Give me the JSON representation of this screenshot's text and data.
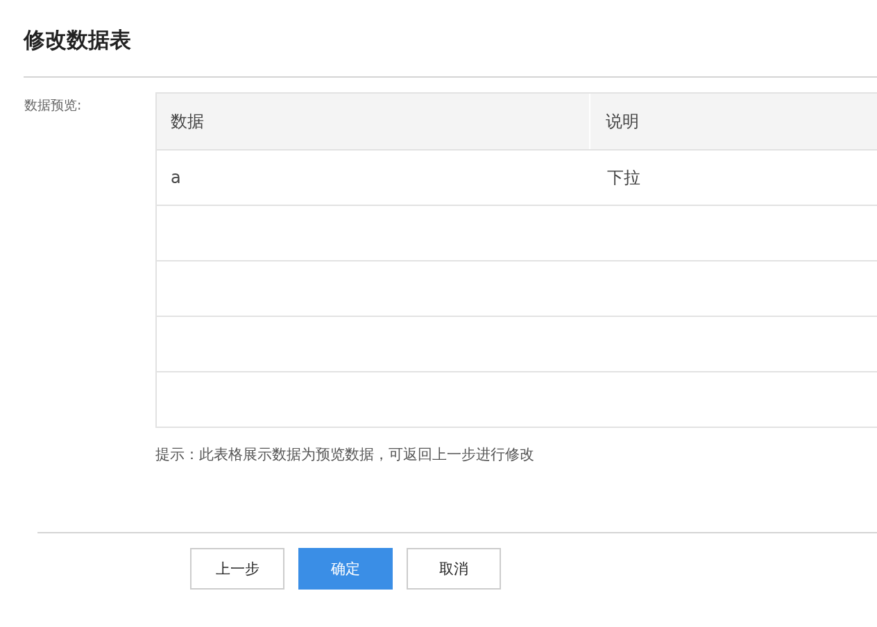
{
  "title": "修改数据表",
  "preview_label": "数据预览:",
  "table": {
    "columns": [
      "数据",
      "说明"
    ],
    "rows": [
      {
        "cells": [
          "a",
          "下拉"
        ]
      }
    ]
  },
  "hint": "提示：此表格展示数据为预览数据，可返回上一步进行修改",
  "buttons": [
    {
      "label": "上一步",
      "kind": "default"
    },
    {
      "label": "确定",
      "kind": "primary"
    },
    {
      "label": "取消",
      "kind": "default"
    }
  ]
}
